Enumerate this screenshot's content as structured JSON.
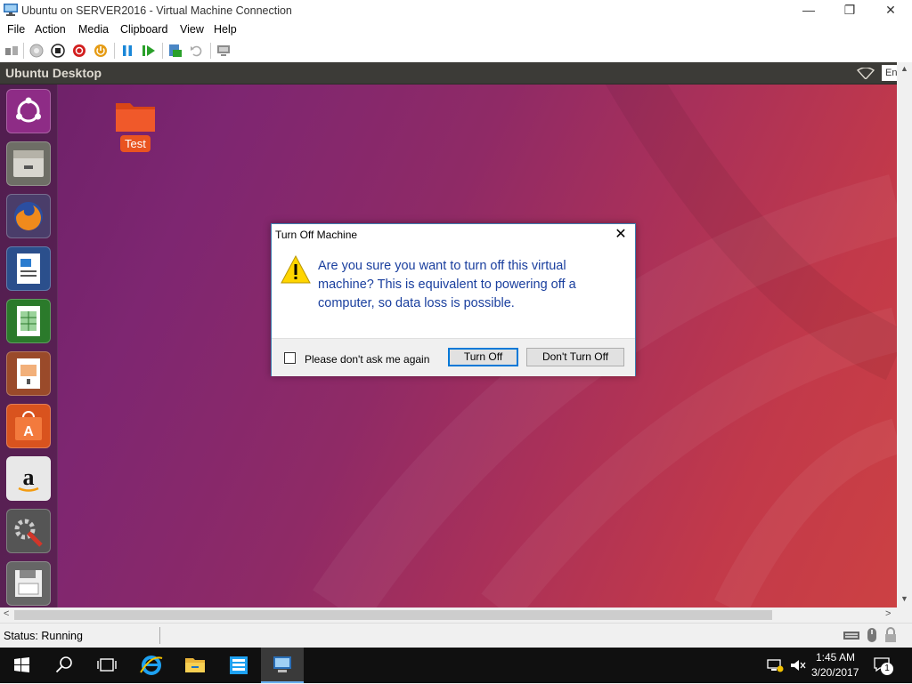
{
  "window": {
    "title": "Ubuntu on SERVER2016 - Virtual Machine Connection",
    "minimize": "—",
    "restore": "❐",
    "close": "✕"
  },
  "menu": [
    "File",
    "Action",
    "Media",
    "Clipboard",
    "View",
    "Help"
  ],
  "toolbar_icons": [
    "ctrl-alt-del-icon",
    "start-icon",
    "turn-off-icon",
    "shut-down-icon",
    "save-state-icon",
    "pause-icon",
    "resume-icon",
    "checkpoint-icon",
    "revert-icon",
    "enhanced-session-icon"
  ],
  "vm": {
    "top_bar_title": "Ubuntu Desktop",
    "lang_indicator": "En",
    "desktop_folder_label": "Test",
    "launcher_icons": [
      "ubuntu-dash-icon",
      "files-icon",
      "firefox-icon",
      "libreoffice-writer-icon",
      "libreoffice-calc-icon",
      "libreoffice-impress-icon",
      "ubuntu-software-icon",
      "amazon-icon",
      "system-settings-icon",
      "save-icon"
    ]
  },
  "dialog": {
    "title": "Turn Off Machine",
    "message": "Are you sure you want to turn off this virtual machine? This is equivalent to powering off a computer, so data loss is possible.",
    "checkbox_label": "Please don't ask me again",
    "checkbox_checked": false,
    "turn_off_button": "Turn Off",
    "dont_turn_off_button": "Don't Turn Off"
  },
  "status": {
    "text": "Status: Running"
  },
  "taskbar": {
    "time": "1:45 AM",
    "date": "3/20/2017",
    "notification_count": "1"
  },
  "colors": {
    "dialog_message": "#1a3f9e",
    "ubuntu_orange": "#e95420",
    "taskbar": "#101010"
  }
}
